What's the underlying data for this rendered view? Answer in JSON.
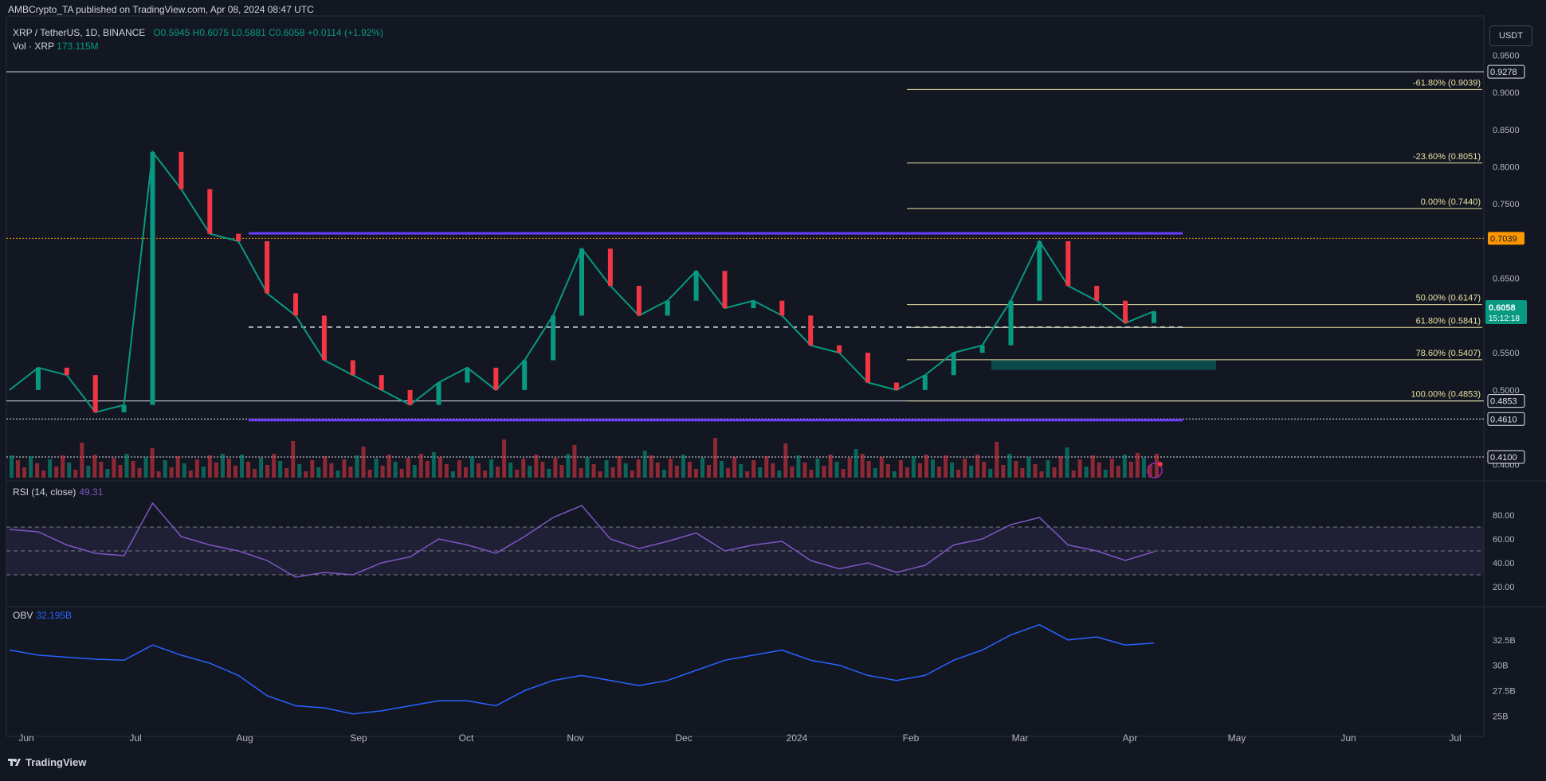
{
  "header": {
    "published": "AMBCrypto_TA published on TradingView.com, Apr 08, 2024 08:47 UTC"
  },
  "symbol": {
    "name": "XRP / TetherUS, 1D, BINANCE",
    "ohlc": "O0.5945 H0.6075 L0.5881 C0.6058 +0.0114 (+1.92%)",
    "volume_label": "Vol · XRP",
    "volume_value": "173.115M"
  },
  "currency_button": "USDT",
  "price_badge": {
    "price": "0.6058",
    "countdown": "15:12:18"
  },
  "rsi": {
    "label": "RSI (14, close)",
    "value": "49.31"
  },
  "obv": {
    "label": "OBV",
    "value": "32.195B"
  },
  "branding": "TradingView",
  "colors": {
    "background": "#131722",
    "up": "#089981",
    "down": "#f23645",
    "fib": "#e7e0a0",
    "channel": "#6a3cff",
    "rsi": "#7e57c2",
    "obv": "#2962ff",
    "orange_level": "#ff9800"
  },
  "chart_data": {
    "type": "line",
    "title": "XRP / TetherUS, 1D, BINANCE",
    "x_ticks": [
      "Jun",
      "Jul",
      "Aug",
      "Sep",
      "Oct",
      "Nov",
      "Dec",
      "2024",
      "Feb",
      "Mar",
      "Apr",
      "May",
      "Jun",
      "Jul"
    ],
    "price_axis": {
      "ylim": [
        0.38,
        0.96
      ],
      "ticks": [
        "0.9500",
        "0.9000",
        "0.8500",
        "0.8000",
        "0.7500",
        "0.6500",
        "0.5500",
        "0.5000",
        "0.4000"
      ]
    },
    "price_levels": [
      {
        "value": 0.9278,
        "label": "0.9278",
        "style": "white-solid"
      },
      {
        "value": 0.7039,
        "label": "0.7039",
        "style": "orange-dotted"
      },
      {
        "value": 0.4853,
        "label": "0.4853",
        "style": "white-solid"
      },
      {
        "value": 0.461,
        "label": "0.4610",
        "style": "white-dotted"
      },
      {
        "value": 0.41,
        "label": "0.4100",
        "style": "white-dotted"
      }
    ],
    "fibonacci": [
      {
        "label": "-61.80% (0.9039)",
        "value": 0.9039
      },
      {
        "label": "-23.60% (0.8051)",
        "value": 0.8051
      },
      {
        "label": "0.00% (0.7440)",
        "value": 0.744
      },
      {
        "label": "50.00% (0.6147)",
        "value": 0.6147
      },
      {
        "label": "61.80% (0.5841)",
        "value": 0.5841
      },
      {
        "label": "78.60% (0.5407)",
        "value": 0.5407
      },
      {
        "label": "100.00% (0.4853)",
        "value": 0.4853
      }
    ],
    "range_channel": {
      "high": 0.7105,
      "mid": 0.5845,
      "low": 0.4595
    },
    "demand_zone": {
      "high": 0.54,
      "low": 0.527
    },
    "price_series": {
      "name": "XRP/USDT",
      "points": [
        [
          "Jun",
          0.5
        ],
        [
          "Jun",
          0.53
        ],
        [
          "Jun",
          0.52
        ],
        [
          "Jul",
          0.47
        ],
        [
          "Jul",
          0.48
        ],
        [
          "Jul",
          0.82
        ],
        [
          "Jul",
          0.77
        ],
        [
          "Jul",
          0.71
        ],
        [
          "Aug",
          0.7
        ],
        [
          "Aug",
          0.63
        ],
        [
          "Aug",
          0.6
        ],
        [
          "Aug",
          0.54
        ],
        [
          "Sep",
          0.52
        ],
        [
          "Sep",
          0.5
        ],
        [
          "Sep",
          0.48
        ],
        [
          "Oct",
          0.51
        ],
        [
          "Oct",
          0.53
        ],
        [
          "Oct",
          0.5
        ],
        [
          "Oct",
          0.54
        ],
        [
          "Nov",
          0.6
        ],
        [
          "Nov",
          0.69
        ],
        [
          "Nov",
          0.64
        ],
        [
          "Nov",
          0.6
        ],
        [
          "Dec",
          0.62
        ],
        [
          "Dec",
          0.66
        ],
        [
          "Dec",
          0.61
        ],
        [
          "Dec",
          0.62
        ],
        [
          "2024",
          0.6
        ],
        [
          "2024",
          0.56
        ],
        [
          "2024",
          0.55
        ],
        [
          "2024",
          0.51
        ],
        [
          "Feb",
          0.5
        ],
        [
          "Feb",
          0.52
        ],
        [
          "Feb",
          0.55
        ],
        [
          "Feb",
          0.56
        ],
        [
          "Mar",
          0.62
        ],
        [
          "Mar",
          0.7
        ],
        [
          "Mar",
          0.64
        ],
        [
          "Mar",
          0.62
        ],
        [
          "Apr",
          0.59
        ],
        [
          "Apr",
          0.6058
        ]
      ]
    },
    "rsi_axis": {
      "ylim": [
        10,
        100
      ],
      "ticks": [
        "80.00",
        "60.00",
        "40.00",
        "20.00"
      ],
      "bands": [
        70,
        50,
        30
      ]
    },
    "rsi_series": {
      "name": "RSI (14, close)",
      "values": [
        68,
        66,
        55,
        48,
        46,
        90,
        62,
        55,
        50,
        42,
        28,
        32,
        30,
        40,
        45,
        60,
        55,
        48,
        62,
        78,
        88,
        60,
        52,
        58,
        65,
        50,
        55,
        58,
        42,
        35,
        40,
        32,
        38,
        55,
        60,
        72,
        78,
        55,
        50,
        42,
        49.31
      ]
    },
    "obv_axis": {
      "ylim": [
        24,
        35
      ],
      "ticks": [
        "32.5B",
        "30B",
        "27.5B",
        "25B"
      ]
    },
    "obv_series": {
      "name": "OBV",
      "values": [
        31.5,
        31.0,
        30.8,
        30.6,
        30.5,
        32.0,
        31.0,
        30.2,
        29.0,
        27.0,
        26.0,
        25.8,
        25.2,
        25.5,
        26.0,
        26.5,
        26.5,
        26.0,
        27.5,
        28.5,
        29.0,
        28.5,
        28.0,
        28.5,
        29.5,
        30.5,
        31.0,
        31.5,
        30.5,
        30.0,
        29.0,
        28.5,
        29.0,
        30.5,
        31.5,
        33.0,
        34.0,
        32.5,
        32.8,
        32.0,
        32.195
      ]
    }
  }
}
